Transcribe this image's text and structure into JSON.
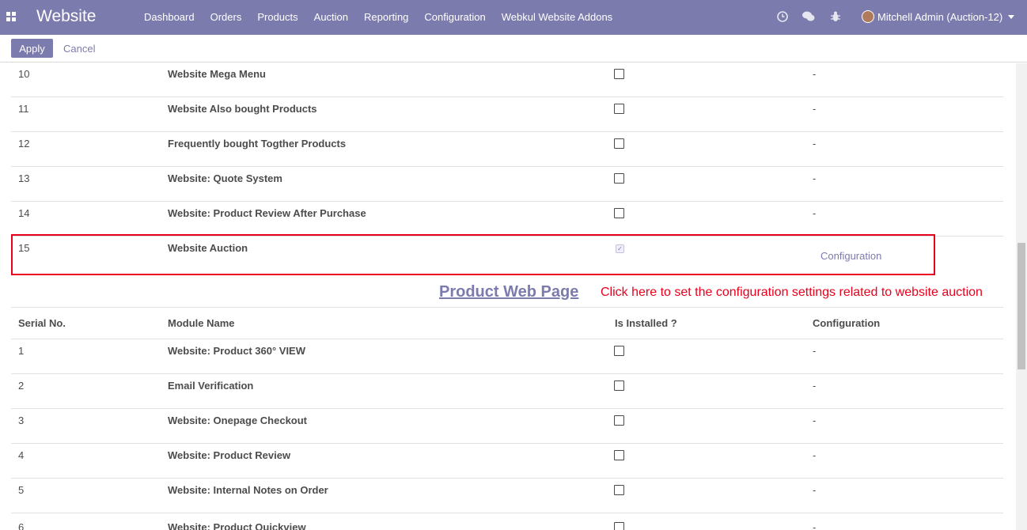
{
  "navbar": {
    "brand": "Website",
    "menu": [
      "Dashboard",
      "Orders",
      "Products",
      "Auction",
      "Reporting",
      "Configuration",
      "Webkul Website Addons"
    ],
    "user": "Mitchell Admin (Auction-12)",
    "icons": [
      "apps-icon",
      "clock-icon",
      "chat-icon",
      "bug-icon"
    ]
  },
  "control_panel": {
    "apply_label": "Apply",
    "cancel_label": "Cancel"
  },
  "top_table": {
    "rows": [
      {
        "serial": "10",
        "name": "Website Mega Menu",
        "installed": false,
        "config": "-"
      },
      {
        "serial": "11",
        "name": "Website Also bought Products",
        "installed": false,
        "config": "-"
      },
      {
        "serial": "12",
        "name": "Frequently bought Togther Products",
        "installed": false,
        "config": "-"
      },
      {
        "serial": "13",
        "name": "Website: Quote System",
        "installed": false,
        "config": "-"
      },
      {
        "serial": "14",
        "name": "Website: Product Review After Purchase",
        "installed": false,
        "config": "-"
      },
      {
        "serial": "15",
        "name": "Website Auction",
        "installed": true,
        "config": "Configuration"
      }
    ]
  },
  "section": {
    "title": "Product Web Page",
    "annotation": "Click here to set the configuration settings related to website auction"
  },
  "bottom_table": {
    "headers": [
      "Serial No.",
      "Module Name",
      "Is Installed ?",
      "Configuration"
    ],
    "rows": [
      {
        "serial": "1",
        "name": "Website: Product 360° VIEW",
        "installed": false,
        "config": "-"
      },
      {
        "serial": "2",
        "name": "Email Verification",
        "installed": false,
        "config": "-"
      },
      {
        "serial": "3",
        "name": "Website: Onepage Checkout",
        "installed": false,
        "config": "-"
      },
      {
        "serial": "4",
        "name": "Website: Product Review",
        "installed": false,
        "config": "-"
      },
      {
        "serial": "5",
        "name": "Website: Internal Notes on Order",
        "installed": false,
        "config": "-"
      },
      {
        "serial": "6",
        "name": "Website: Product Quickview",
        "installed": false,
        "config": "-"
      }
    ]
  },
  "colors": {
    "brand": "#7c7bad",
    "highlight": "#e8001c"
  }
}
